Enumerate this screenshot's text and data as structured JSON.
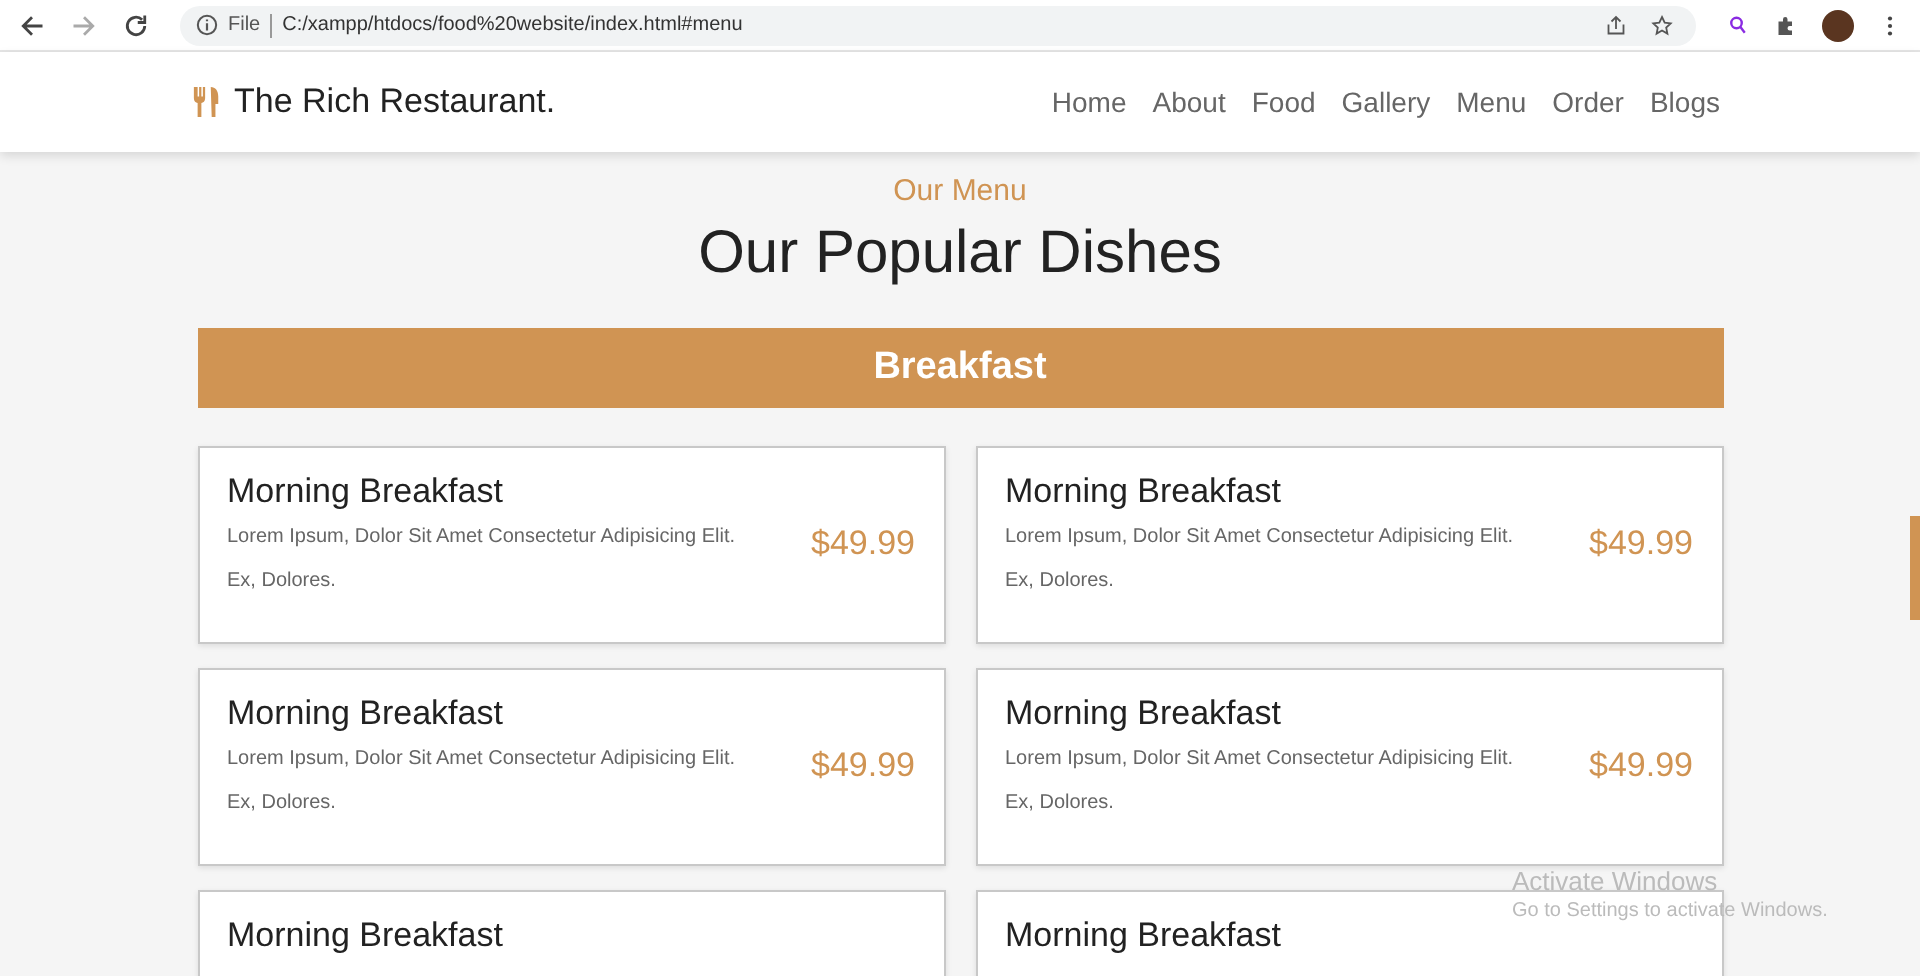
{
  "browser": {
    "url_scheme": "File",
    "url": "C:/xampp/htdocs/food%20website/index.html#menu"
  },
  "header": {
    "logo": "The Rich Restaurant.",
    "nav": [
      {
        "label": "Home"
      },
      {
        "label": "About"
      },
      {
        "label": "Food"
      },
      {
        "label": "Gallery"
      },
      {
        "label": "Menu"
      },
      {
        "label": "Order"
      },
      {
        "label": "Blogs"
      }
    ]
  },
  "section": {
    "subtitle": "Our Menu",
    "title": "Our Popular Dishes",
    "category": "Breakfast"
  },
  "dishes": [
    {
      "name": "Morning Breakfast",
      "description": "Lorem Ipsum, Dolor Sit Amet Consectetur Adipisicing Elit. Ex, Dolores.",
      "price": "$49.99"
    },
    {
      "name": "Morning Breakfast",
      "description": "Lorem Ipsum, Dolor Sit Amet Consectetur Adipisicing Elit. Ex, Dolores.",
      "price": "$49.99"
    },
    {
      "name": "Morning Breakfast",
      "description": "Lorem Ipsum, Dolor Sit Amet Consectetur Adipisicing Elit. Ex, Dolores.",
      "price": "$49.99"
    },
    {
      "name": "Morning Breakfast",
      "description": "Lorem Ipsum, Dolor Sit Amet Consectetur Adipisicing Elit. Ex, Dolores.",
      "price": "$49.99"
    },
    {
      "name": "Morning Breakfast"
    },
    {
      "name": "Morning Breakfast"
    }
  ],
  "os_overlay": {
    "title": "Activate Windows",
    "text": "Go to Settings to activate Windows."
  }
}
